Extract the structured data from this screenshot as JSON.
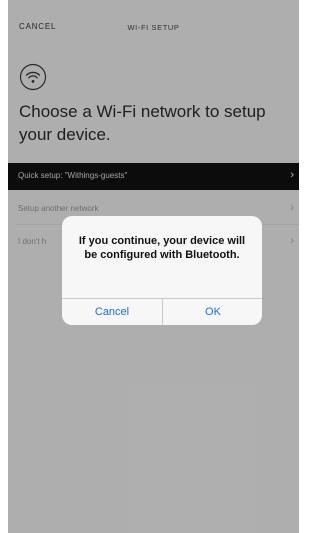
{
  "topbar": {
    "cancel_label": "CANCEL",
    "title": "WI-FI SETUP"
  },
  "icons": {
    "wifi": "wifi-icon",
    "chevron": "chevron-right-icon"
  },
  "heading": "Choose a Wi-Fi network to setup your device.",
  "networks": [
    {
      "label": "Quick setup: \"Withings-guests\"",
      "selected": true
    },
    {
      "label": "Setup another network",
      "selected": false
    },
    {
      "label": "I don't h",
      "selected": false
    }
  ],
  "chevron_glyph": "›",
  "dialog": {
    "message": "If you continue, your device will be configured with Bluetooth.",
    "cancel_label": "Cancel",
    "ok_label": "OK"
  },
  "colors": {
    "selected_row": "#111111",
    "accent": "#1e6be6",
    "background": "#f2f2f2"
  }
}
